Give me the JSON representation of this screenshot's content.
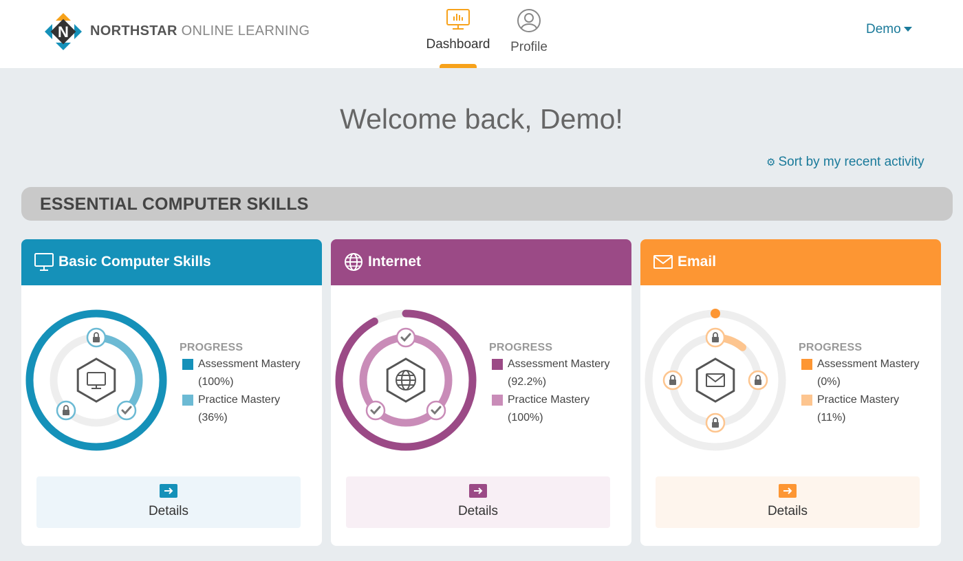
{
  "header": {
    "brand_bold": "NORTHSTAR",
    "brand_light": "ONLINE LEARNING",
    "logo_letter": "N",
    "nav": [
      {
        "label": "Dashboard",
        "icon": "dashboard-monitor-icon",
        "active": true
      },
      {
        "label": "Profile",
        "icon": "user-circle-icon",
        "active": false
      }
    ],
    "user_menu": "Demo",
    "accent": "#f7a21b"
  },
  "welcome": "Welcome back, Demo!",
  "sort_link": "Sort by my recent activity",
  "section": {
    "title": "ESSENTIAL COMPUTER SKILLS"
  },
  "cards": [
    {
      "title": "Basic Computer Skills",
      "icon": "monitor-icon",
      "color": "#1591b9",
      "light_color": "#6cbad4",
      "progress_label": "PROGRESS",
      "assessment_label": "Assessment Mastery",
      "assessment_value": "(100%)",
      "assessment_fraction": 1.0,
      "practice_label": "Practice Mastery",
      "practice_value": "(36%)",
      "practice_fraction": 0.36,
      "details_label": "Details"
    },
    {
      "title": "Internet",
      "icon": "globe-icon",
      "color": "#9b4a86",
      "light_color": "#c98cb8",
      "progress_label": "PROGRESS",
      "assessment_label": "Assessment Mastery",
      "assessment_value": "(92.2%)",
      "assessment_fraction": 0.922,
      "practice_label": "Practice Mastery",
      "practice_value": "(100%)",
      "practice_fraction": 1.0,
      "details_label": "Details"
    },
    {
      "title": "Email",
      "icon": "envelope-icon",
      "color": "#fd9633",
      "light_color": "#fdc58f",
      "progress_label": "PROGRESS",
      "assessment_label": "Assessment Mastery",
      "assessment_value": "(0%)",
      "assessment_fraction": 0.0,
      "practice_label": "Practice Mastery",
      "practice_value": "(11%)",
      "practice_fraction": 0.11,
      "details_label": "Details"
    }
  ]
}
